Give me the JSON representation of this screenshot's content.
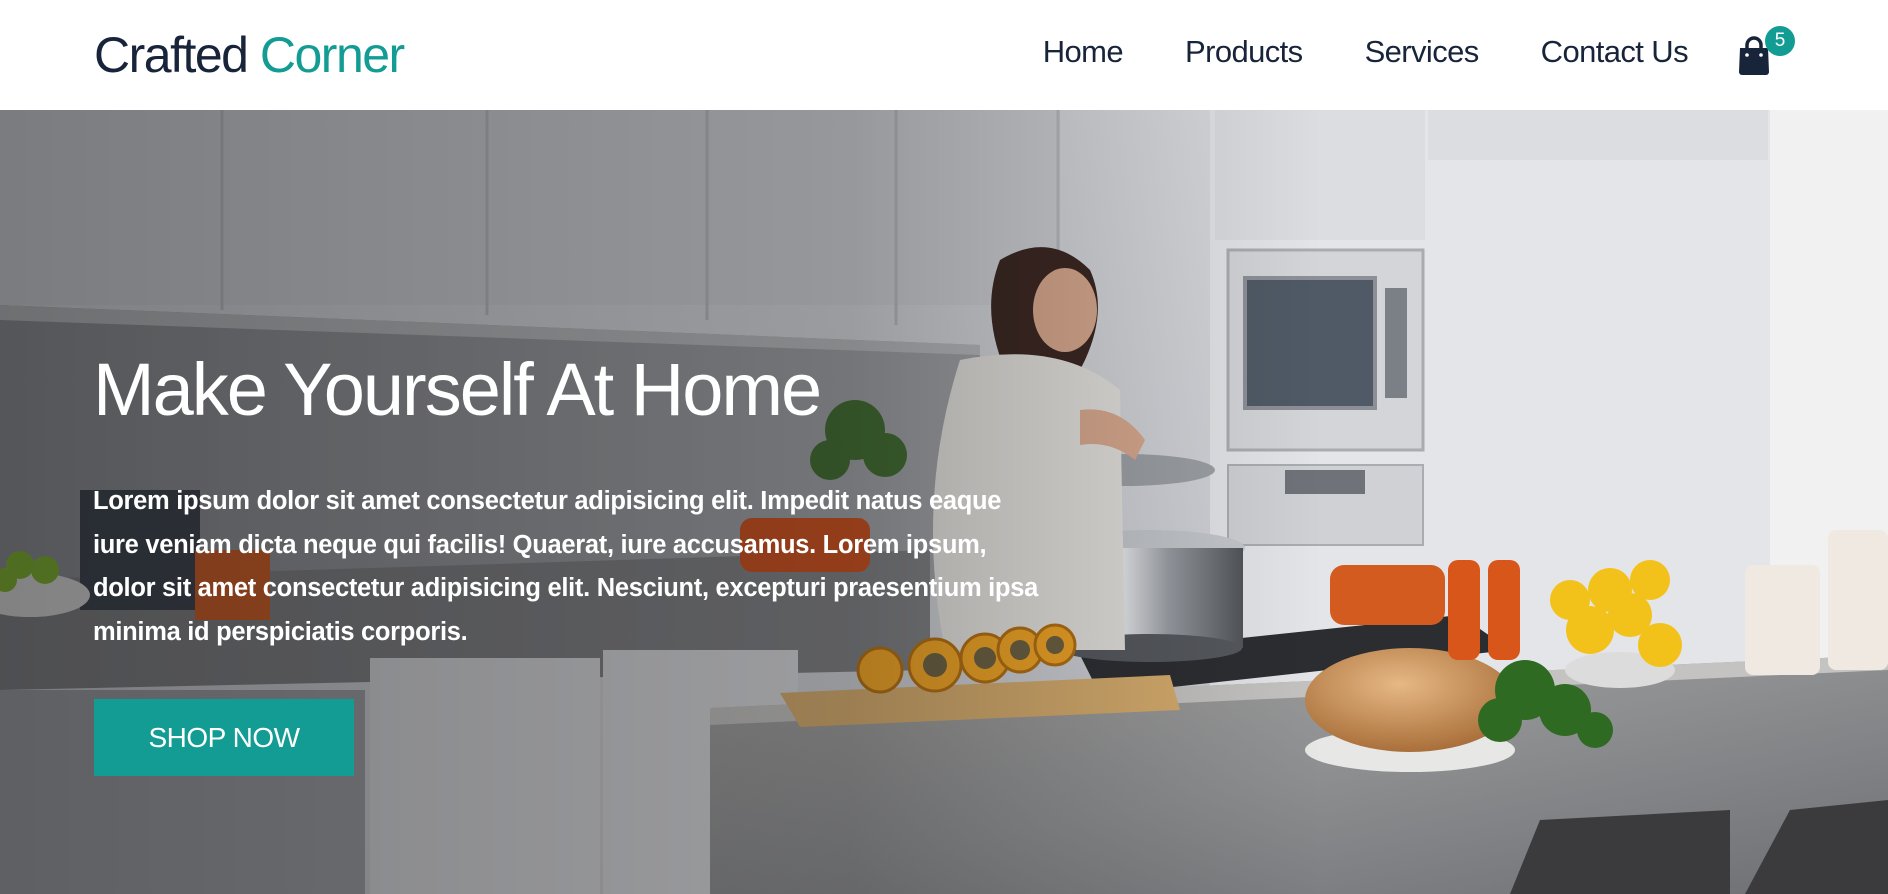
{
  "brand": {
    "part1": "Crafted",
    "part2": "Corner"
  },
  "nav": [
    {
      "label": "Home"
    },
    {
      "label": "Products"
    },
    {
      "label": "Services"
    },
    {
      "label": "Contact Us"
    }
  ],
  "cart": {
    "count": "5",
    "icon": "shopping-bag-icon"
  },
  "hero": {
    "title": "Make Yourself At Home",
    "text": "Lorem ipsum dolor sit amet consectetur adipisicing elit. Impedit natus eaque iure veniam dicta neque qui facilis! Quaerat, iure accusamus. Lorem ipsum, dolor sit amet consectetur adipisicing elit. Nesciunt, excepturi praesentium ipsa minima id perspiciatis corporis.",
    "button": "SHOP NOW"
  },
  "colors": {
    "accent": "#129c93",
    "brand_dark": "#17243a"
  }
}
